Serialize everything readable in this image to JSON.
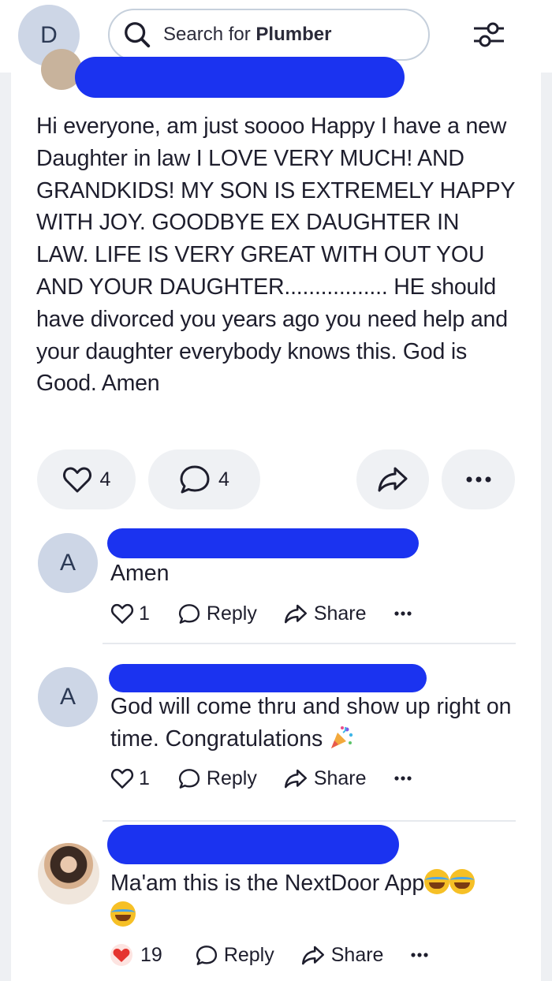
{
  "topbar": {
    "user_initial": "D",
    "search_prefix": "Search for ",
    "search_term": "Plumber"
  },
  "post": {
    "text": "Hi everyone, am just soooo Happy I have a new Daughter in law I LOVE VERY MUCH! AND GRANDKIDS! MY SON IS EXTREMELY HAPPY WITH JOY. GOODBYE EX DAUGHTER IN LAW. LIFE IS VERY GREAT WITH OUT YOU AND YOUR DAUGHTER................. HE should have divorced you years ago you need help and your daughter everybody knows this. God is Good. Amen",
    "likes": "4",
    "comments": "4"
  },
  "comments": [
    {
      "initial": "A",
      "text": "Amen",
      "likes": "1",
      "reply_label": "Reply",
      "share_label": "Share"
    },
    {
      "initial": "A",
      "text": "God will come thru and show up right on time. Congratulations",
      "emoji": "party-popper",
      "likes": "1",
      "reply_label": "Reply",
      "share_label": "Share"
    },
    {
      "initial": "",
      "text": "Ma'am this is the NextDoor App",
      "emoji": "tears-of-joy x3",
      "likes": "19",
      "reply_label": "Reply",
      "share_label": "Share"
    }
  ],
  "colors": {
    "redaction": "#1b33f0",
    "avatar_bg": "#cdd6e6",
    "pill_bg": "#eff1f4",
    "heart": "#e5342f"
  }
}
